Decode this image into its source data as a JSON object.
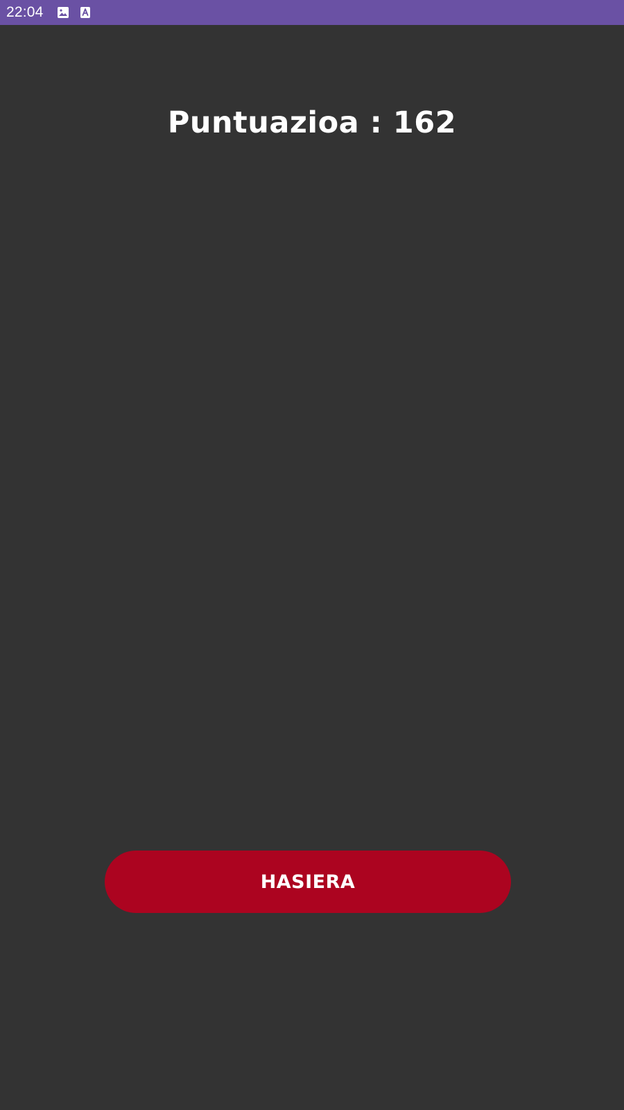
{
  "status_bar": {
    "time": "22:04",
    "background_color": "#6a51a4",
    "icons": [
      "image-icon",
      "store-icon"
    ]
  },
  "score": {
    "text": "Puntuazioa : 162"
  },
  "home_button": {
    "label": "HASIERA",
    "color": "#ac0420"
  },
  "theme": {
    "background_color": "#333333",
    "text_color": "#ffffff"
  }
}
